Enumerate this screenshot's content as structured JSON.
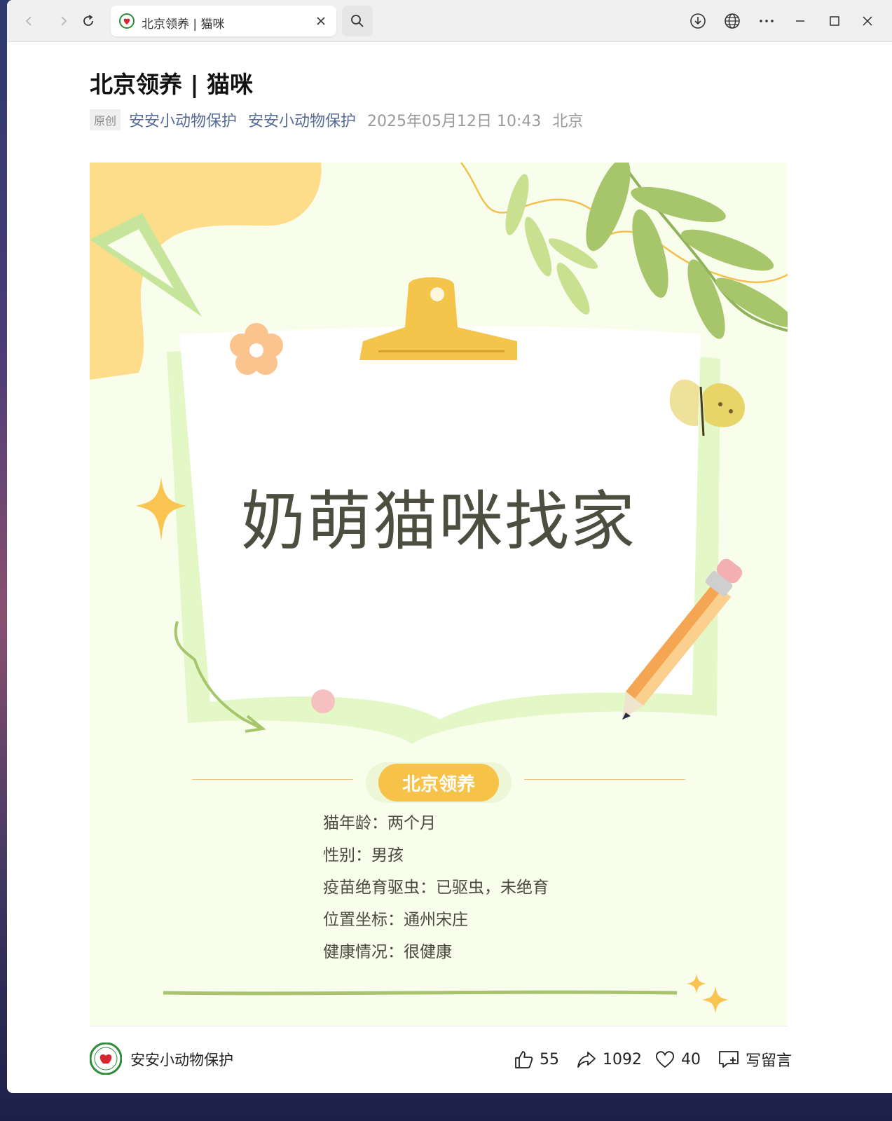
{
  "browser": {
    "tab_title": "北京领养 | 猫咪"
  },
  "article": {
    "title": "北京领养 | 猫咪",
    "badge": "原创",
    "author_link_1": "安安小动物保护",
    "author_link_2": "安安小动物保护",
    "datetime": "2025年05月12日 10:43",
    "location": "北京"
  },
  "poster": {
    "headline": "奶萌猫咪找家",
    "pill_label": "北京领养",
    "info_lines": [
      "猫年龄：两个月",
      "性别：男孩",
      "疫苗绝育驱虫：已驱虫，未绝育",
      "位置坐标：通州宋庄",
      "健康情况：很健康"
    ]
  },
  "footer": {
    "account_name": "安安小动物保护",
    "likes": "55",
    "shares": "1092",
    "favorites": "40",
    "comment_label": "写留言"
  },
  "icons": {
    "back": "arrow-left-icon",
    "forward": "arrow-right-icon",
    "refresh": "refresh-icon",
    "close_tab": "close-icon",
    "search": "search-icon",
    "download": "download-icon",
    "translate": "globe-icon",
    "more": "more-dots-icon",
    "minimize": "minimize-icon",
    "maximize": "maximize-icon",
    "close_window": "close-icon",
    "like": "thumbs-up-icon",
    "share": "share-arrow-icon",
    "favorite": "heart-icon",
    "comment": "comment-icon"
  },
  "colors": {
    "link": "#576b95",
    "pill": "#f6c348",
    "poster_bg": "#f8fdec"
  }
}
